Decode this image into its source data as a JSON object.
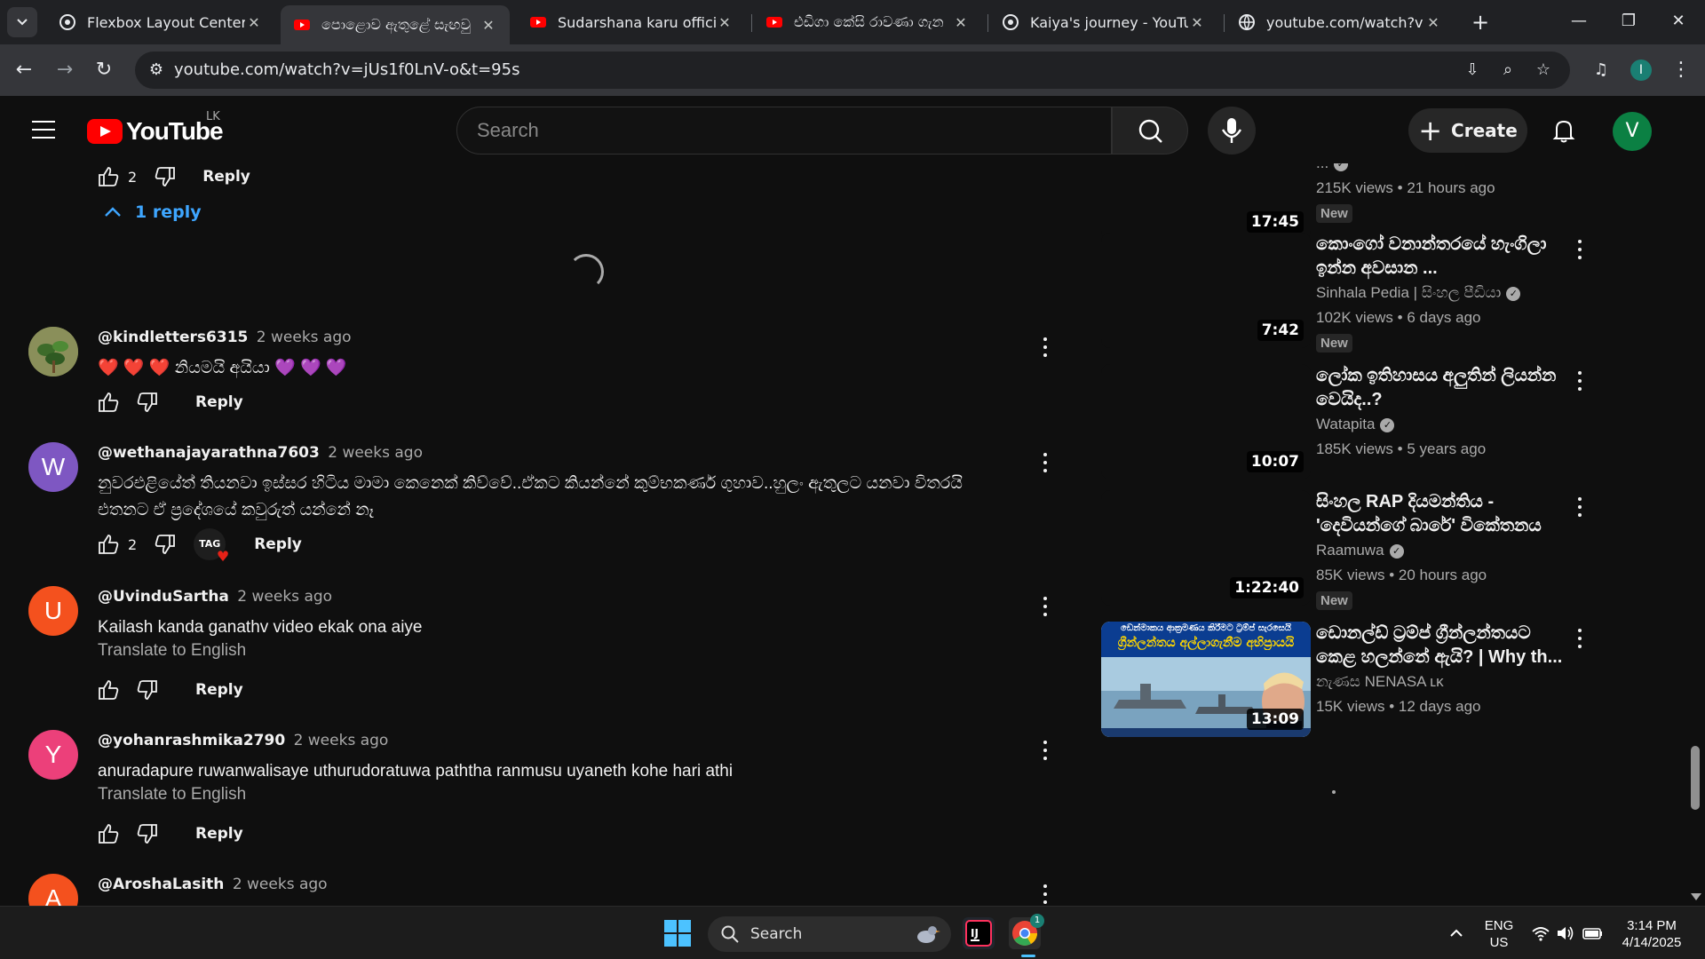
{
  "browser": {
    "tabs": [
      {
        "title": "Flexbox Layout Centering",
        "favicon": "openai-icon",
        "active": false
      },
      {
        "title": "පොළොව ඇතුළේ සැඟවු",
        "favicon": "youtube-icon",
        "active": true
      },
      {
        "title": "Sudarshana karu official - Y",
        "favicon": "youtube-icon",
        "active": false
      },
      {
        "title": "එඩිගා කේසි රාවණා ගැන",
        "favicon": "youtube-icon",
        "active": false
      },
      {
        "title": "Kaiya's journey - YouTube",
        "favicon": "openai-icon",
        "active": false
      },
      {
        "title": "youtube.com/watch?v=oc",
        "favicon": "globe-icon",
        "active": false
      }
    ],
    "url": "youtube.com/watch?v=jUs1f0LnV-o&t=95s",
    "profile_initial": "I"
  },
  "youtube": {
    "logo_text": "YouTube",
    "country": "LK",
    "search_placeholder": "Search",
    "create_label": "Create",
    "avatar_initial": "V",
    "colors": {
      "brand": "#ff0000",
      "link": "#3ea6ff",
      "bg": "#0f0f0f"
    }
  },
  "comments": {
    "top_thread": {
      "likes": "2",
      "reply_label": "Reply",
      "replies_toggle": "1 reply"
    },
    "items": [
      {
        "author": "@kindletters6315",
        "time": "2 weeks ago",
        "text": "❤️ ❤️ ❤️ නියමයි අයියා 💜 💜 💜",
        "likes": "",
        "reply_label": "Reply",
        "avatar_initial": "",
        "avatar_color": "#6b7b3a"
      },
      {
        "author": "@wethanajayarathna7603",
        "time": "2 weeks ago",
        "text": "නුවරඑළියේත් තියනවා ඉස්සර හිටිය මාමා කෙනෙක් කිව්වේ..ඒකට කියන්නේ කුම්භකර්ණ ගුහාව..හුලං ඇතුලට යනවා විතරයි එතනට ඒ ප්‍රදේශයේ කවුරුත් යන්නේ නෑ",
        "likes": "2",
        "reply_label": "Reply",
        "avatar_initial": "W",
        "avatar_color": "#7e57c2",
        "creator_heart": "TAG"
      },
      {
        "author": "@UvinduSartha",
        "time": "2 weeks ago",
        "text": "Kailash kanda ganathv video ekak ona aiye",
        "translate": "Translate to English",
        "likes": "",
        "reply_label": "Reply",
        "avatar_initial": "U",
        "avatar_color": "#f4511e"
      },
      {
        "author": "@yohanrashmika2790",
        "time": "2 weeks ago",
        "text": "anuradapure ruwanwalisaye uthurudoratuwa paththa ranmusu uyaneth kohe hari athi",
        "translate": "Translate to English",
        "likes": "",
        "reply_label": "Reply",
        "avatar_initial": "Y",
        "avatar_color": "#ec407a"
      },
      {
        "author": "@AroshaLasith",
        "time": "2 weeks ago",
        "text": "",
        "likes": "",
        "reply_label": "Reply",
        "avatar_initial": "A",
        "avatar_color": "#f4511e"
      }
    ]
  },
  "recommendations": [
    {
      "title": "",
      "channel": "...",
      "views": "215K views • 21 hours ago",
      "duration": "17:45",
      "badge": "New"
    },
    {
      "title": "කොංගෝ වනාන්තරයේ හැංගිලා ඉන්න අවසාන ...",
      "channel": "Sinhala Pedia | සිංහල පීඩියා",
      "views": "102K views • 6 days ago",
      "duration": "7:42",
      "badge": "New"
    },
    {
      "title": "ලෝක ඉතිහාසය අලුතින් ලියන්න වෙයිද..?",
      "channel": "Watapita",
      "views": "185K views • 5 years ago",
      "duration": "10:07",
      "badge": ""
    },
    {
      "title": "සිංහල RAP දියමන්තිය - 'දෙවියන්ගේ බාරේ' විකේතනය",
      "channel": "Raamuwa",
      "views": "85K views • 20 hours ago",
      "duration": "1:22:40",
      "badge": "New"
    },
    {
      "title": "ඩොනල්ඩ් ට්‍රම්ප් ග්‍රීන්ලන්තයට කෙළ හලන්නේ ඇයි? | Why th...",
      "channel": "නැණස NENASA ʟᴋ",
      "views": "15K views • 12 days ago",
      "duration": "13:09",
      "badge": "",
      "thumb_caption_top": "ඩෙන්මාකය ආක්‍රමණය කිරීමට ට්‍රම්ප් සැරසෙයි",
      "thumb_caption_main": "ග්‍රීන්ලන්තය අල්ලාගැනීම අභිප්‍රායයි"
    }
  ],
  "taskbar": {
    "search_label": "Search",
    "lang_line1": "ENG",
    "lang_line2": "US",
    "time": "3:14 PM",
    "date": "4/14/2025",
    "chrome_badge": "1"
  }
}
